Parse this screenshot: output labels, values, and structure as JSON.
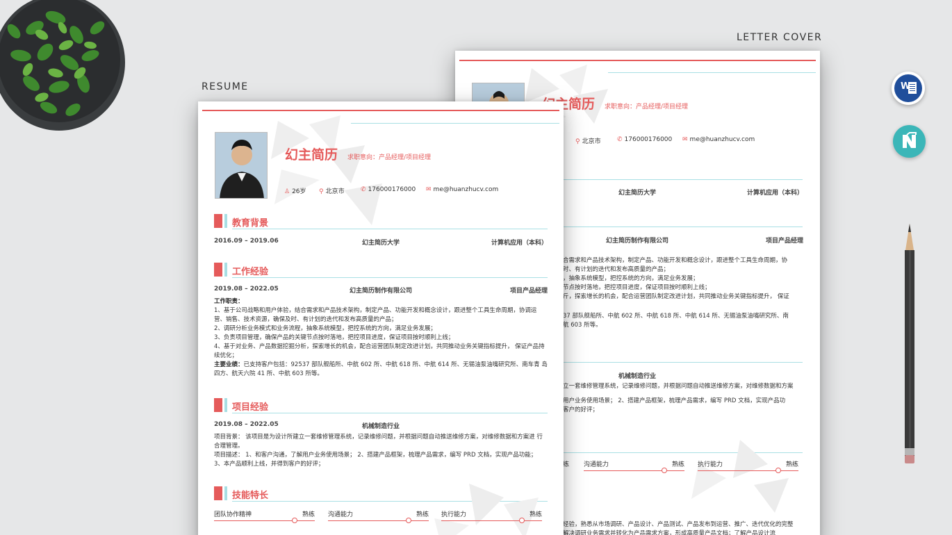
{
  "labels": {
    "resume": "RESUME",
    "cover": "LETTER COVER"
  },
  "resume": {
    "name": "幻主简历",
    "intent": "求职意向：产品经理/项目经理",
    "age": "26岁",
    "city": "北京市",
    "phone": "176000176000",
    "email": "me@huanzhucv.com",
    "sections": {
      "education": "教育背景",
      "work": "工作经验",
      "project": "项目经验",
      "skills": "技能特长"
    },
    "education": {
      "date": "2016.09 – 2019.06",
      "school": "幻主简历大学",
      "major": "计算机应用（本科）"
    },
    "work": {
      "date": "2019.08 – 2022.05",
      "company": "幻主简历制作有限公司",
      "role": "项目产品经理",
      "duty_label": "工作职责：",
      "duties": [
        "1、基于公司战略和用户体验，结合需求和产品技术架构，制定产品、功能开发和概念设计，跟进整个工具生命周期，协调运营、销售、技术资源，确保及时、有计划的迭代和发布高质量的产品；",
        "2、调研分析业务模式和业务流程，抽象系统模型，把控系统的方向，满足业务发展；",
        "3、负责项目管理，确保产品的关键节点按时落地，把控项目进度，保证项目按时顺利上线；",
        "4、基于对业务、产品数据挖掘分析，探索增长的机会，配合运营团队制定改进计划，共同推动业务关键指标提升， 保证产品持续优化；"
      ],
      "achievement_label": "主要业绩：",
      "achievement": "已支持客户包括：92537 部队舰船所、中航 602 所、中航 618 所、中航 614 所、无锡油泵油嘴研究所、南车青 岛四方、航天六院 41 所、中航 603 所等。"
    },
    "project": {
      "date": "2019.08 – 2022.05",
      "industry": "机械制造行业",
      "background": "项目背景： 该项目是为设计所建立一套维修管理系统，记录维修问题，并根据问题自动推送维修方案，对维修数据和方案进 行合理管理。",
      "description": "项目描述： 1、和客户沟通，了解用户业务使用场景； 2、搭建产品框架，梳理产品需求，编写 PRD 文档，实现产品功能； 3、本产品顺利上线，并得到客户的好评；"
    },
    "skills": [
      {
        "name": "团队协作精神",
        "level": "熟练",
        "value": 0.8
      },
      {
        "name": "沟通能力",
        "level": "熟练",
        "value": 0.8
      },
      {
        "name": "执行能力",
        "level": "熟练",
        "value": 0.8
      }
    ]
  },
  "cover": {
    "name": "幻主简历",
    "intent": "求职意向：产品经理/项目经理",
    "city": "北京市",
    "phone": "176000176000",
    "email": "me@huanzhucv.com",
    "school": "幻主简历大学",
    "major": "计算机应用（本科）",
    "company": "幻主简历制作有限公司",
    "role": "项目产品经理",
    "lines": [
      "合需求和产品技术架构，制定产品、功能开发和概念设计，跟进整个工具生命周期，协",
      "时、有计划的迭代和发布高质量的产品；",
      "，抽象系统模型，把控系统的方向，满足业务发展；",
      "节点按时落地，把控项目进度，保证项目按时顺利上线；",
      "斤，探索增长的机会，配合运营团队制定改进计划，共同推动业务关键指标提升， 保证"
    ],
    "clients": [
      "37 部队舰船所、中航 602 所、中航 618 所、中航 614 所、无锡油泵油嘴研究所、南",
      "航 603 所等。"
    ],
    "industry": "机械制造行业",
    "project_lines": [
      "立一套维修管理系统，记录维修问题，并根据问题自动推送维修方案，对维修数据和方案",
      "用户业务使用场景； 2、搭建产品框架，梳理产品需求，编写 PRD 文档，实现产品功",
      "客户的好评；"
    ],
    "skills": [
      {
        "name": "练",
        "level": ""
      },
      {
        "name": "沟通能力",
        "level": "熟练",
        "value": 0.8
      },
      {
        "name": "执行能力",
        "level": "熟练",
        "value": 0.8
      }
    ],
    "bottom_lines": [
      "经验，熟悉从市场调研、产品设计、产品测试、产品发布到运营、推广、迭代优化的完整",
      "解决调研业务需求并转化为产品需求方案，形成高质量产品文档；了解产品设计流"
    ]
  },
  "icons": {
    "word": "word-app-icon",
    "notion": "notion-app-icon"
  },
  "colors": {
    "accent": "#e55a5a",
    "secondary": "#a8dfe4",
    "word": "#1f4e9b",
    "notion": "#3bb6b8"
  }
}
